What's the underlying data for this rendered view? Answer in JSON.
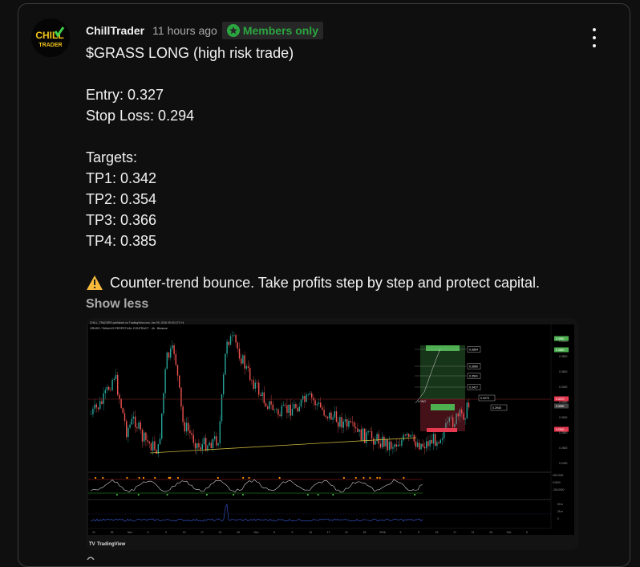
{
  "author": {
    "name": "ChillTrader",
    "avatar_text_top": "CHILL",
    "avatar_text_bottom": "TRADER"
  },
  "post_meta": {
    "time": "11 hours ago",
    "badge": "Members only",
    "accent": "#2ba640"
  },
  "post": {
    "title": "$GRASS LONG (high risk trade)",
    "entry": "Entry: 0.327",
    "stop_loss": "Stop Loss: 0.294",
    "targets_label": "Targets:",
    "tp1": "TP1: 0.342",
    "tp2": "TP2: 0.354",
    "tp3": "TP3: 0.366",
    "tp4": "TP4: 0.385",
    "warning": "Counter-trend bounce. Take profits step by step and protect capital."
  },
  "show_less": "Show less",
  "chart": {
    "header_line": "CHILL_TRADERS published on TradingView.com, Jan 09, 2026 09:03 UTC+4",
    "symbol_line": "GRASS / TetherUS PERPETUAL CONTRACT · 4h · Binance",
    "price_axis": [
      "0.4000",
      "0.3800",
      "0.3600",
      "0.3400",
      "0.3200",
      "0.3000",
      "0.2800",
      "0.2600",
      "0.2400"
    ],
    "price_tags": [
      "0.3950",
      "0.3850",
      "0.3270",
      "0.3050",
      "0.2940"
    ],
    "target_labels": [
      "0.3854",
      "0.3660",
      "0.3541",
      "0.3417"
    ],
    "entry_label": "0.3270",
    "stop_label": "0.2940",
    "position_label": "LONG",
    "osc_axis": [
      "200.0000",
      "0.0000",
      "-200.0000"
    ],
    "vol_axis": [
      "50 m",
      "25 m",
      "0"
    ],
    "time_axis": [
      "21",
      "25",
      "Nov",
      "5",
      "9",
      "13",
      "17",
      "21",
      "25",
      "Dec",
      "5",
      "9",
      "13",
      "17",
      "21",
      "25",
      "2026",
      "5",
      "9",
      "13",
      "17",
      "21",
      "25",
      "Feb",
      "5"
    ],
    "footer_brand": "TradingView",
    "colors": {
      "up": "#26a69a",
      "down": "#ef5350",
      "target": "#4caf50",
      "stop": "#e53950",
      "support": "#c9b53c",
      "osc": "#d0d0d0"
    }
  }
}
